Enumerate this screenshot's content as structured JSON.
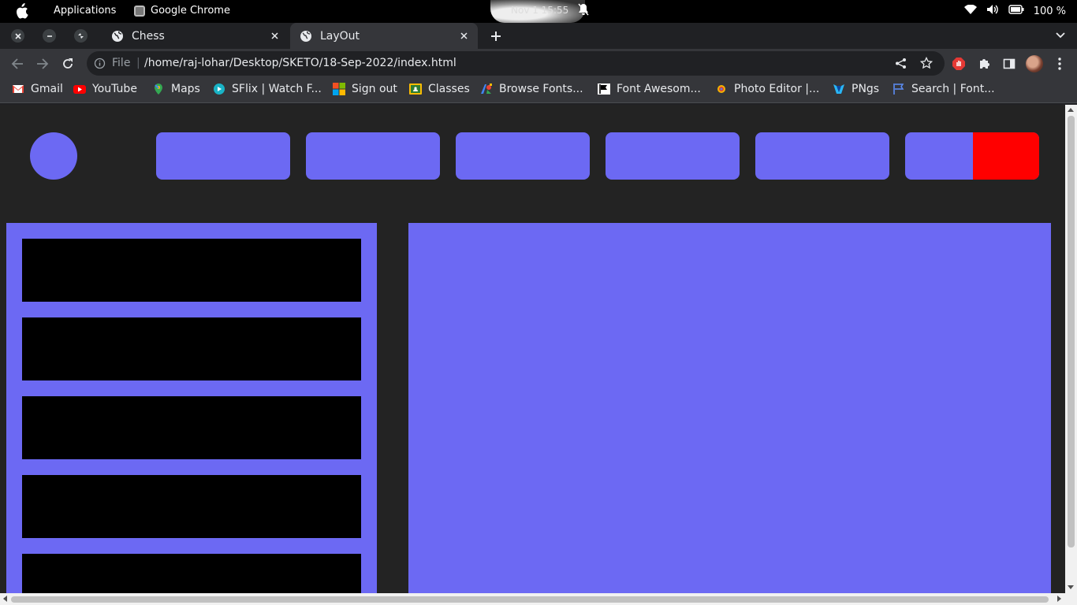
{
  "os": {
    "applications_label": "Applications",
    "active_app_label": "Google Chrome",
    "clock": "Nov 1  15:55",
    "battery": "100 %"
  },
  "tabs": [
    {
      "title": "Chess",
      "icon": "globe-icon",
      "active": false
    },
    {
      "title": "LayOut",
      "icon": "globe-icon",
      "active": true
    }
  ],
  "omnibox": {
    "scheme_label": "File",
    "url": "/home/raj-lohar/Desktop/SKETO/18-Sep-2022/index.html"
  },
  "bookmarks": [
    {
      "label": "Gmail",
      "icon": "gmail-icon"
    },
    {
      "label": "YouTube",
      "icon": "youtube-icon"
    },
    {
      "label": "Maps",
      "icon": "maps-icon"
    },
    {
      "label": "SFlix | Watch F...",
      "icon": "sflix-icon"
    },
    {
      "label": "Sign out",
      "icon": "microsoft-icon"
    },
    {
      "label": "Classes",
      "icon": "classroom-icon"
    },
    {
      "label": "Browse Fonts...",
      "icon": "google-fonts-icon"
    },
    {
      "label": "Font Awesom...",
      "icon": "font-awesome-icon"
    },
    {
      "label": "Photo Editor |...",
      "icon": "photo-editor-icon"
    },
    {
      "label": "PNgs",
      "icon": "pngs-icon"
    },
    {
      "label": "Search | Font...",
      "icon": "flag-icon"
    }
  ],
  "colors": {
    "accent": "#6c69f3",
    "highlight": "#ff0000",
    "page_bg": "#232323",
    "item_bg": "#000000"
  }
}
